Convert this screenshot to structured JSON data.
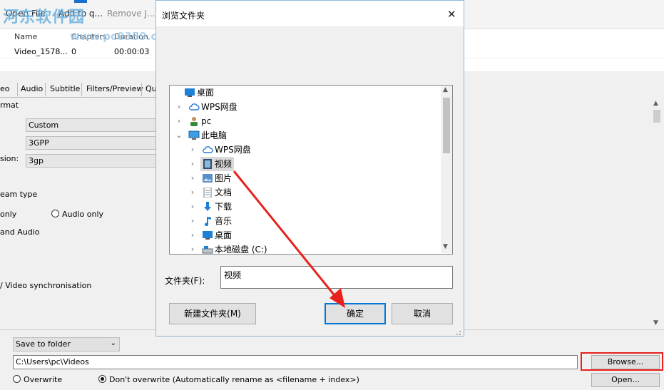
{
  "app": {
    "toolbar": {
      "open_file": "Open File",
      "add_to_queue": "Add to q...",
      "remove": "Remove J..."
    },
    "watermark": {
      "text": "河东软件园",
      "url": "www.pc0359.cn"
    },
    "list": {
      "columns": [
        "Name",
        "Chapters",
        "Duration"
      ],
      "rows": [
        {
          "name": "Video_1578...",
          "chapters": "0",
          "duration": "00:00:03"
        }
      ]
    },
    "tabs": [
      "eo",
      "Audio",
      "Subtitle",
      "Filters/Preview",
      "Qu"
    ],
    "settings": {
      "format_label": "rmat",
      "format_value": "Custom",
      "container_value": "3GPP",
      "extension_label": "sion:",
      "extension_value": "3gp",
      "stream_type_label": "eam type",
      "option_only": "only",
      "option_audio_only": "Audio only",
      "option_and_audio": "and Audio",
      "sync_label": "/ Video synchronisation"
    },
    "output": {
      "save_mode": "Save to folder",
      "path": "C:\\Users\\pc\\Videos",
      "browse_label": "Browse...",
      "open_label": "Open...",
      "overwrite_label": "Overwrite",
      "dont_overwrite_label": "Don't overwrite (Automatically rename as <filename + index>)"
    }
  },
  "dialog": {
    "title": "浏览文件夹",
    "close_glyph": "✕",
    "tree": [
      {
        "label": "桌面",
        "icon": "desktop-icon",
        "level": 0,
        "chevron": ""
      },
      {
        "label": "WPS网盘",
        "icon": "cloud-icon",
        "level": 1,
        "chevron": "›"
      },
      {
        "label": "pc",
        "icon": "user-icon",
        "level": 1,
        "chevron": "›"
      },
      {
        "label": "此电脑",
        "icon": "computer-icon",
        "level": 1,
        "chevron": "⌄"
      },
      {
        "label": "WPS网盘",
        "icon": "cloud-icon",
        "level": 2,
        "chevron": "›"
      },
      {
        "label": "视频",
        "icon": "video-folder-icon",
        "level": 2,
        "chevron": "›",
        "selected": true
      },
      {
        "label": "图片",
        "icon": "pictures-folder-icon",
        "level": 2,
        "chevron": "›"
      },
      {
        "label": "文档",
        "icon": "documents-folder-icon",
        "level": 2,
        "chevron": "›"
      },
      {
        "label": "下载",
        "icon": "download-icon",
        "level": 2,
        "chevron": "›"
      },
      {
        "label": "音乐",
        "icon": "music-icon",
        "level": 2,
        "chevron": "›"
      },
      {
        "label": "桌面",
        "icon": "desktop-icon",
        "level": 2,
        "chevron": "›"
      },
      {
        "label": "本地磁盘 (C:)",
        "icon": "drive-icon",
        "level": 2,
        "chevron": "›"
      }
    ],
    "folder_label": "文件夹(F):",
    "folder_value": "视频",
    "new_folder_label": "新建文件夹(M)",
    "ok_label": "确定",
    "cancel_label": "取消"
  },
  "colors": {
    "annotation_red": "#e8211c",
    "selection_gray": "#d9d9d9",
    "focus_blue": "#0078d7"
  }
}
